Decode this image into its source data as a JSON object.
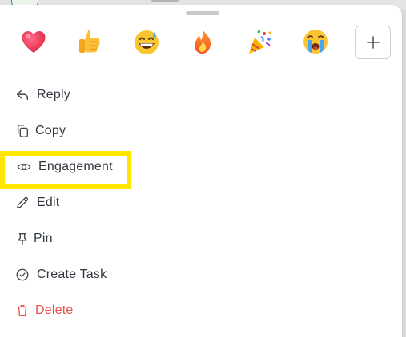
{
  "reactions": [
    {
      "name": "red-heart",
      "icon": "heart-emoji-icon"
    },
    {
      "name": "thumbs-up",
      "icon": "thumbs-up-emoji-icon"
    },
    {
      "name": "grinning-sweat",
      "icon": "grinning-sweat-emoji-icon"
    },
    {
      "name": "fire",
      "icon": "fire-emoji-icon"
    },
    {
      "name": "party-popper",
      "icon": "party-popper-emoji-icon"
    },
    {
      "name": "crying",
      "icon": "crying-emoji-icon"
    }
  ],
  "add_reaction_icon": "plus-icon",
  "menu": {
    "reply": "Reply",
    "copy": "Copy",
    "engagement": "Engagement",
    "edit": "Edit",
    "pin": "Pin",
    "create_task": "Create Task",
    "delete": "Delete"
  },
  "colors": {
    "text": "#333840",
    "danger": "#e5534b",
    "highlight": "#ffe600"
  }
}
